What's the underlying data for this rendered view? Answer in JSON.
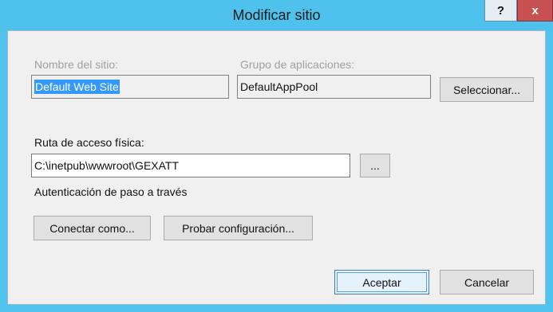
{
  "window": {
    "title": "Modificar sitio",
    "help_label": "?",
    "close_label": "x",
    "colors": {
      "titlebar": "#4ec2ed",
      "close": "#c75050",
      "client": "#f0f0f0",
      "selection": "#3399ff"
    }
  },
  "site": {
    "name_label": "Nombre del sitio:",
    "name_value": "Default Web Site"
  },
  "app_pool": {
    "label": "Grupo de aplicaciones:",
    "value": "DefaultAppPool",
    "select_button": "Seleccionar..."
  },
  "physical_path": {
    "label": "Ruta de acceso física:",
    "value": "C:\\inetpub\\wwwroot\\GEXATT",
    "browse_button": "..."
  },
  "auth": {
    "label": "Autenticación de paso a través",
    "connect_as_button": "Conectar como...",
    "test_settings_button": "Probar configuración..."
  },
  "footer": {
    "ok_button": "Aceptar",
    "cancel_button": "Cancelar"
  }
}
